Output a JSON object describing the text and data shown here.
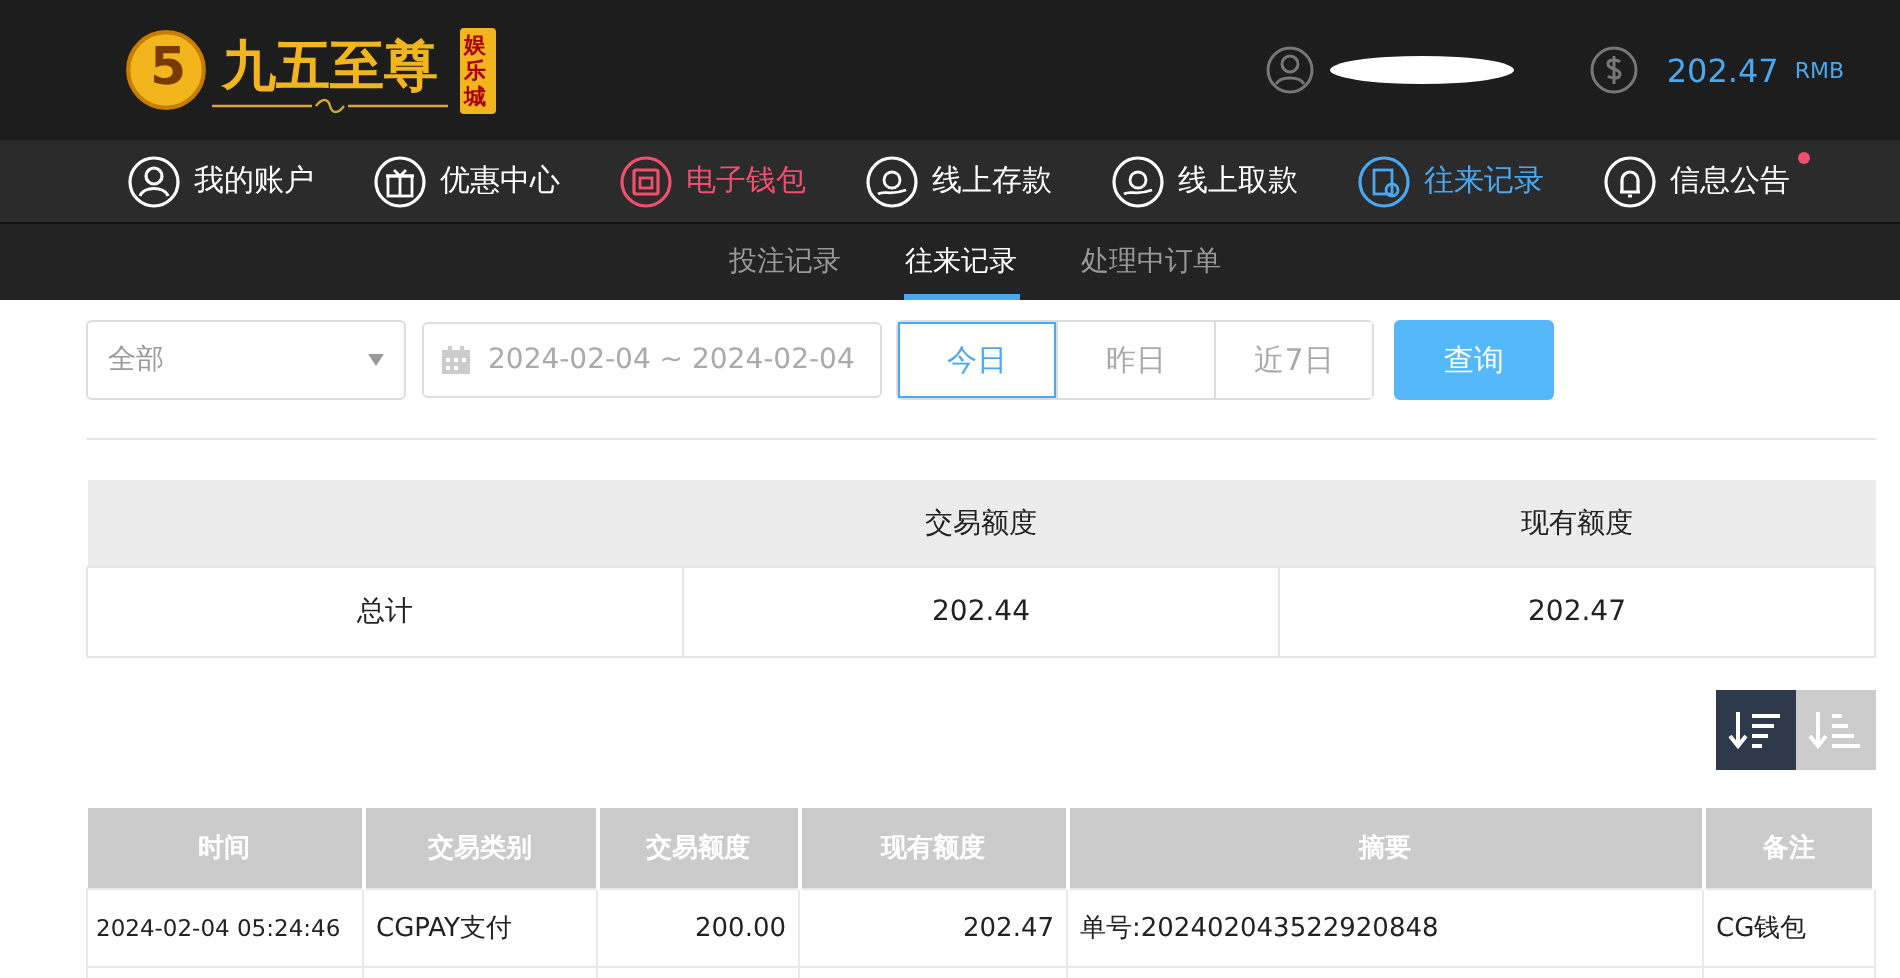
{
  "logo": {
    "digit": "5",
    "name": "九五至尊",
    "badge": "娱乐城"
  },
  "account": {
    "balance": "202.47",
    "currency": "RMB"
  },
  "nav": [
    {
      "label": "我的账户",
      "kind": "plain",
      "dot": false
    },
    {
      "label": "优惠中心",
      "kind": "plain",
      "dot": false
    },
    {
      "label": "电子钱包",
      "kind": "featured",
      "dot": false
    },
    {
      "label": "线上存款",
      "kind": "plain",
      "dot": false
    },
    {
      "label": "线上取款",
      "kind": "plain",
      "dot": false
    },
    {
      "label": "往来记录",
      "kind": "current",
      "dot": false
    },
    {
      "label": "信息公告",
      "kind": "plain",
      "dot": true
    }
  ],
  "subtabs": [
    {
      "label": "投注记录",
      "selected": false
    },
    {
      "label": "往来记录",
      "selected": true
    },
    {
      "label": "处理中订单",
      "selected": false
    }
  ],
  "filter": {
    "type": "全部",
    "date_range": "2024-02-04 ~ 2024-02-04",
    "ranges": [
      {
        "label": "今日",
        "selected": true
      },
      {
        "label": "昨日",
        "selected": false
      },
      {
        "label": "近7日",
        "selected": false
      }
    ],
    "query": "查询"
  },
  "summary": {
    "columns": [
      "交易额度",
      "现有额度"
    ],
    "row": [
      "总计",
      "202.44",
      "202.47"
    ]
  },
  "sort": [
    {
      "selected": true
    },
    {
      "selected": false
    }
  ],
  "table": {
    "columns": [
      "时间",
      "交易类别",
      "交易额度",
      "现有额度",
      "摘要",
      "备注"
    ],
    "rows": [
      [
        "2024-02-04 05:24:46",
        "CGPAY支付",
        "200.00",
        "202.47",
        "单号:202402043522920848",
        "CG钱包"
      ]
    ]
  }
}
